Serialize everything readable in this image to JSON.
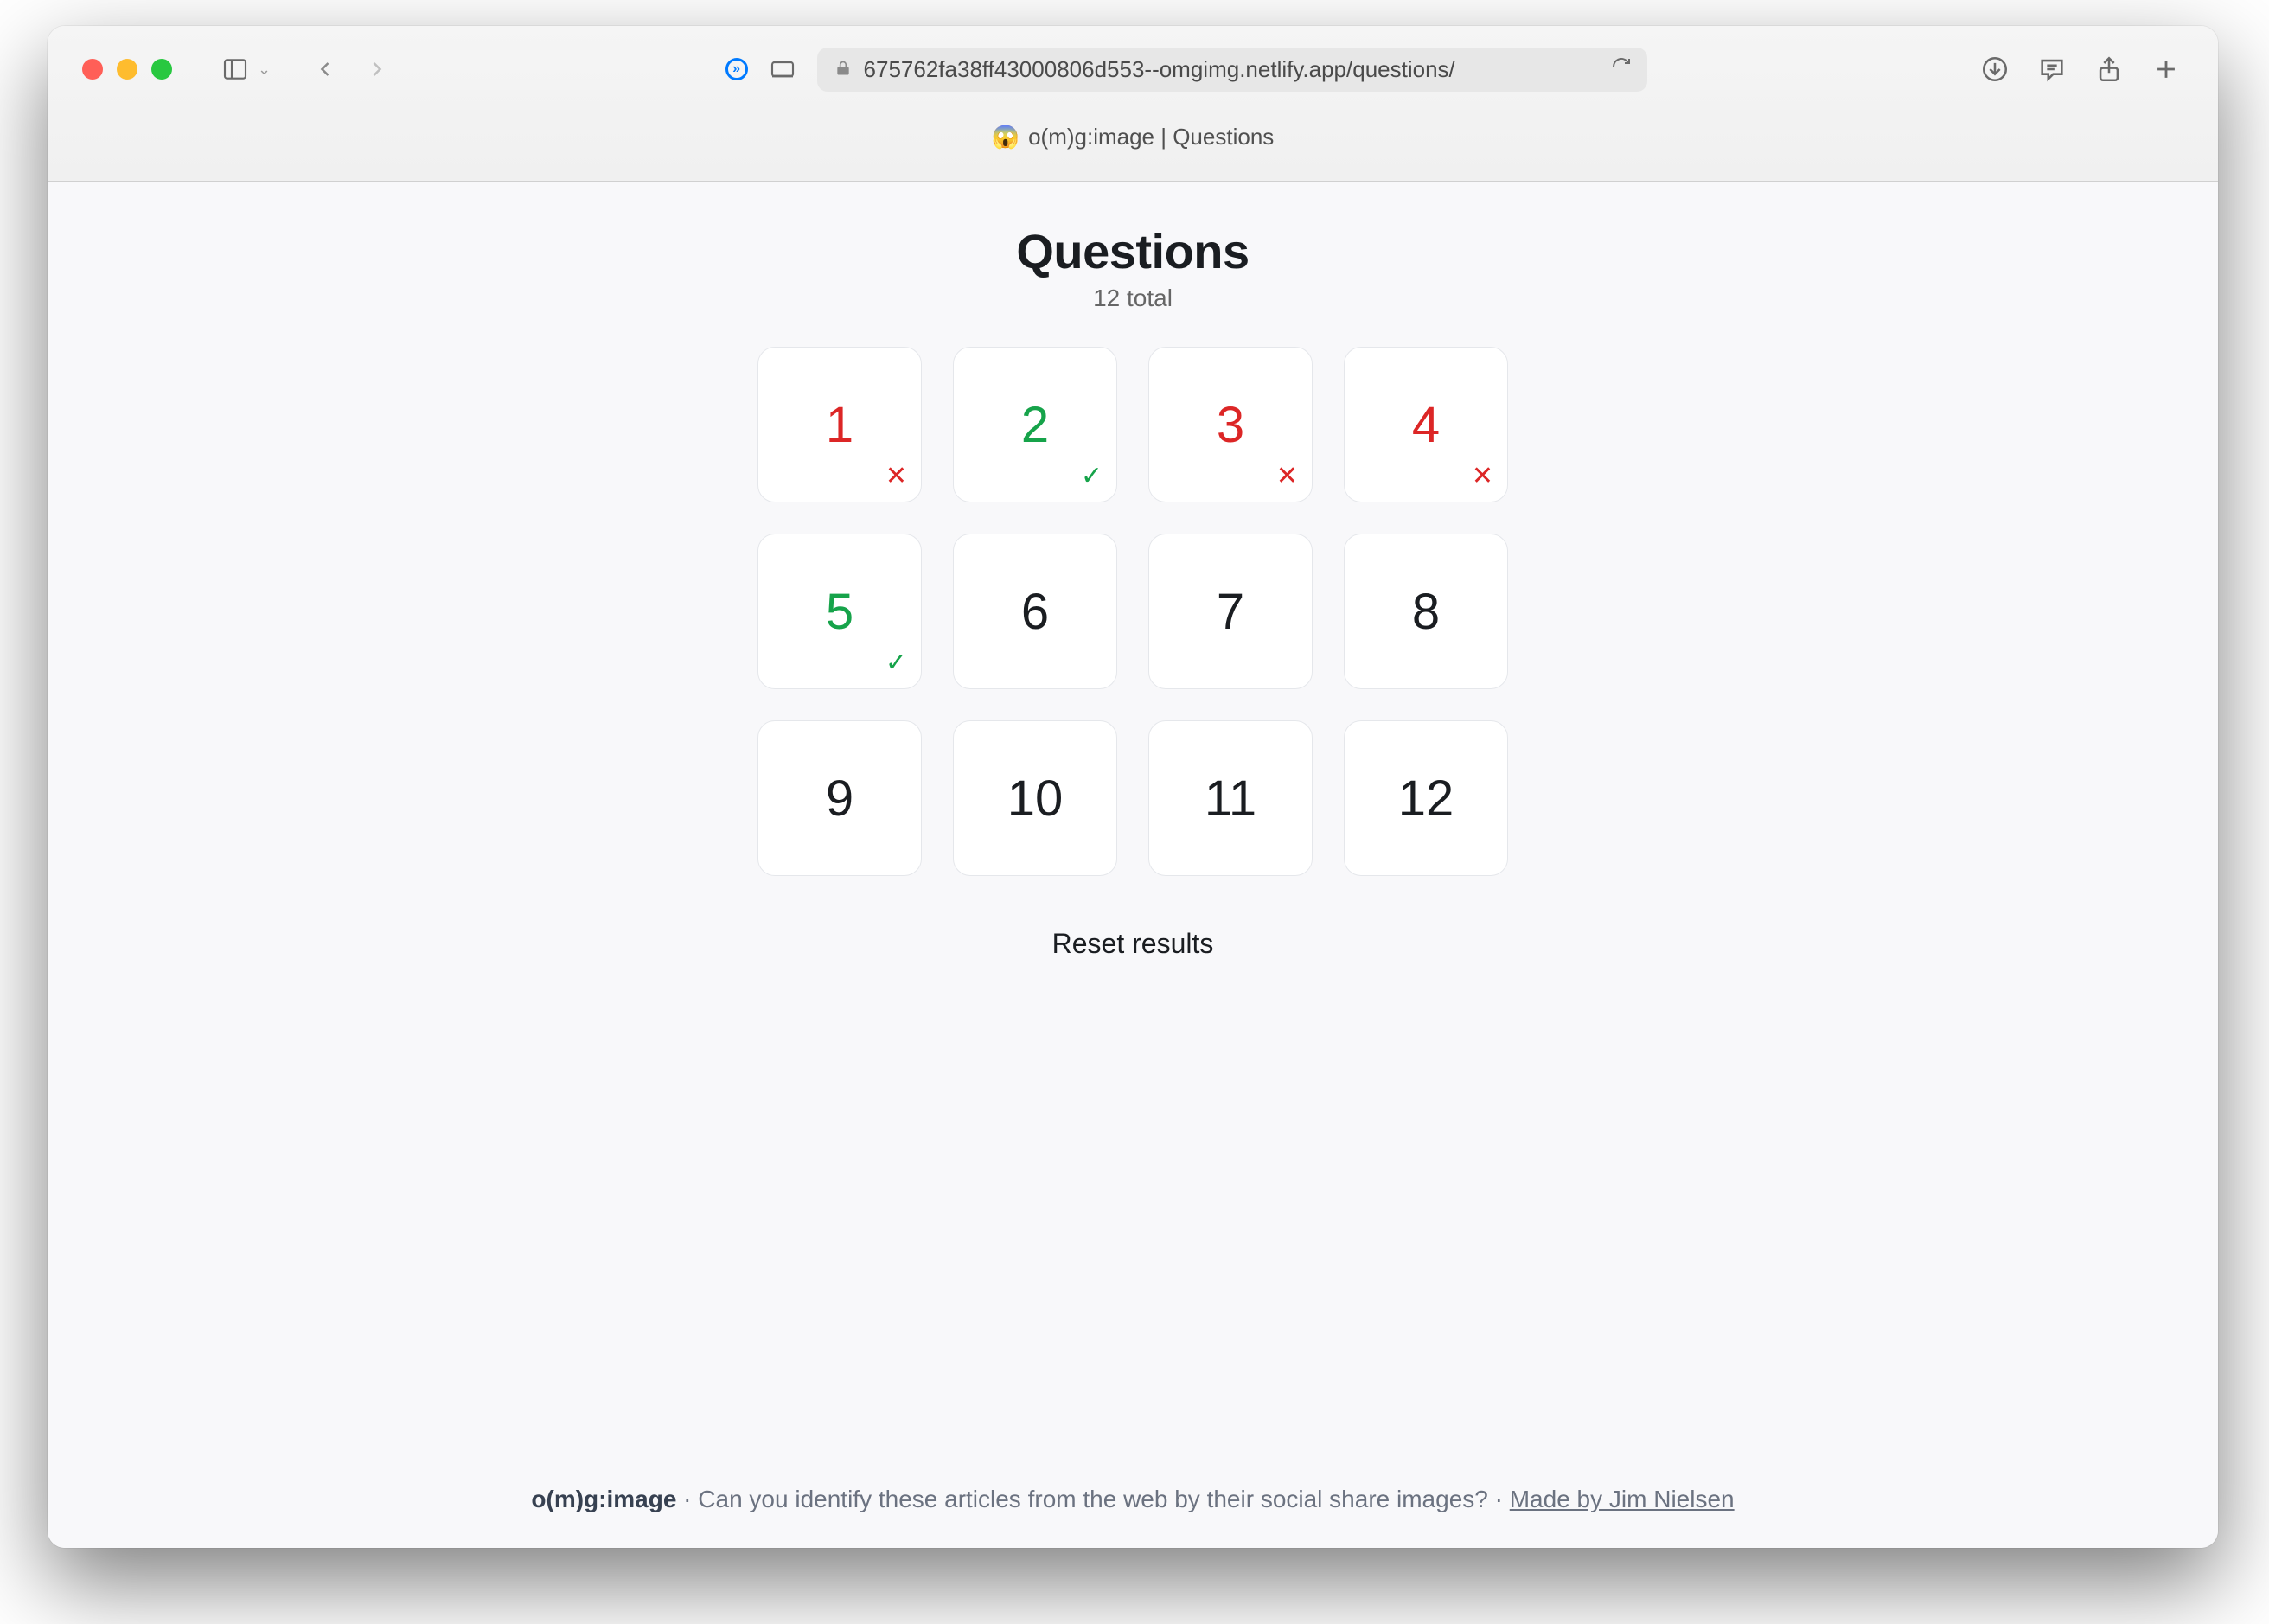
{
  "browser": {
    "url": "675762fa38ff43000806d553--omgimg.netlify.app/questions/",
    "tab_icon": "😱",
    "tab_title": "o(m)g:image | Questions"
  },
  "page": {
    "title": "Questions",
    "subtitle": "12 total",
    "reset_label": "Reset results"
  },
  "questions": [
    {
      "n": "1",
      "status": "incorrect"
    },
    {
      "n": "2",
      "status": "correct"
    },
    {
      "n": "3",
      "status": "incorrect"
    },
    {
      "n": "4",
      "status": "incorrect"
    },
    {
      "n": "5",
      "status": "correct"
    },
    {
      "n": "6",
      "status": "unanswered"
    },
    {
      "n": "7",
      "status": "unanswered"
    },
    {
      "n": "8",
      "status": "unanswered"
    },
    {
      "n": "9",
      "status": "unanswered"
    },
    {
      "n": "10",
      "status": "unanswered"
    },
    {
      "n": "11",
      "status": "unanswered"
    },
    {
      "n": "12",
      "status": "unanswered"
    }
  ],
  "footer": {
    "brand": "o(m)g:image",
    "sep1": " · ",
    "tagline": "Can you identify these articles from the web by their social share images?",
    "sep2": " · ",
    "credit": "Made by Jim Nielsen"
  }
}
